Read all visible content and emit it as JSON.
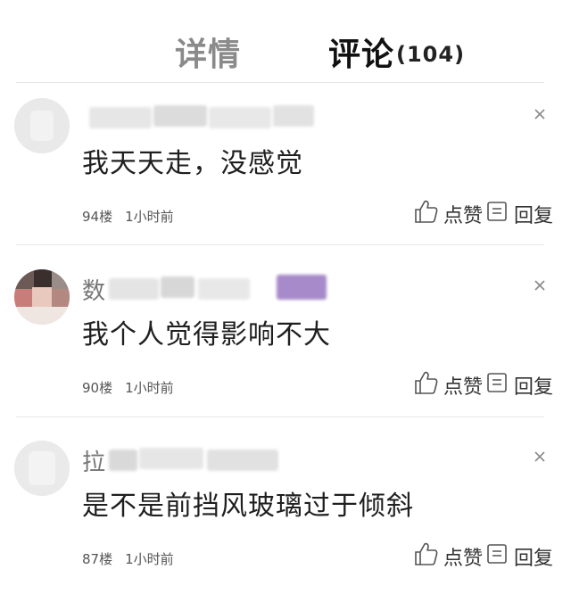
{
  "tabs": {
    "detail_label": "详情",
    "comments_label": "评论",
    "comments_count": "(104)"
  },
  "actions": {
    "like_label": "点赞",
    "reply_label": "回复"
  },
  "comments": [
    {
      "name_visible": "",
      "content": "我天天走，没感觉",
      "floor": "94楼",
      "time": "1小时前"
    },
    {
      "name_visible": "数",
      "content": "我个人觉得影响不大",
      "floor": "90楼",
      "time": "1小时前"
    },
    {
      "name_visible": "拉",
      "content": "是不是前挡风玻璃过于倾斜",
      "floor": "87楼",
      "time": "1小时前"
    }
  ],
  "icons": {
    "close": "close-icon",
    "like": "thumbs-up-icon",
    "reply": "comment-reply-icon"
  },
  "colors": {
    "active_tab": "#111111",
    "inactive_tab": "#8a8a8a",
    "divider": "#e7e7e7"
  }
}
